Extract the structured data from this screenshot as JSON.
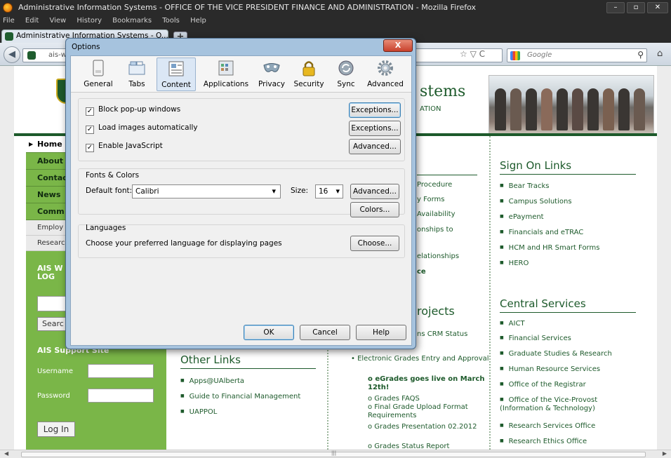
{
  "window": {
    "title": "Administrative Information Systems - OFFICE OF THE VICE PRESIDENT FINANCE AND ADMINISTRATION - Mozilla Firefox",
    "minimize": "–",
    "maximize": "▫",
    "close": "✕"
  },
  "menu": [
    "File",
    "Edit",
    "View",
    "History",
    "Bookmarks",
    "Tools",
    "Help"
  ],
  "tab": {
    "label": "Administrative Information Systems - O...",
    "new_tab": "+"
  },
  "nav": {
    "url": "ais-w",
    "search_placeholder": "Google",
    "back": "◀",
    "home": "⌂",
    "url_icons": "☆ ▽ C"
  },
  "site": {
    "name_partial": "stems",
    "unit_partial": "ATION",
    "left_nav": [
      "Home",
      "About",
      "Contac",
      "News",
      "Comm"
    ],
    "left_sub": [
      "Employ",
      "Researc"
    ],
    "ais_web": "AIS W LOG",
    "search_button": "Searc",
    "support_title": "AIS Support Site",
    "username_label": "Username",
    "password_label": "Password",
    "login_button": "Log In",
    "mid_links": [
      "Procedure",
      "y Forms",
      "Availability",
      "onships to",
      "elationships",
      "ce"
    ],
    "green_projects": "rojects",
    "crm_status": "ns CRM Status",
    "grades": {
      "head": "Electronic Grades Entry and Approval",
      "live": "eGrades goes live on March 12th!",
      "faqs": "Grades FAQS",
      "upload": "Final Grade Upload Format Requirements",
      "presentation": "Grades Presentation 02.2012",
      "status": "Grades Status Report"
    },
    "other_links_title": "Other Links",
    "other_links": [
      "Apps@UAlberta",
      "Guide to Financial Management",
      "UAPPOL"
    ],
    "signon_title": "Sign On Links",
    "signon_links": [
      "Bear Tracks",
      "Campus Solutions",
      "ePayment",
      "Financials and eTRAC",
      "HCM and HR Smart Forms",
      "HERO"
    ],
    "central_title": "Central Services",
    "central_links": [
      "AICT",
      "Financial Services",
      "Graduate Studies & Research",
      "Human Resource Services",
      "Office of the Registrar",
      "Office of the Vice-Provost (Information & Technology)",
      "Research Services Office",
      "Research Ethics Office"
    ]
  },
  "dialog": {
    "title": "Options",
    "close": "X",
    "tabs": [
      {
        "label": "General",
        "icon": "general-icon"
      },
      {
        "label": "Tabs",
        "icon": "tabs-icon"
      },
      {
        "label": "Content",
        "icon": "content-icon",
        "selected": true
      },
      {
        "label": "Applications",
        "icon": "applications-icon"
      },
      {
        "label": "Privacy",
        "icon": "privacy-mask-icon"
      },
      {
        "label": "Security",
        "icon": "padlock-icon"
      },
      {
        "label": "Sync",
        "icon": "sync-icon"
      },
      {
        "label": "Advanced",
        "icon": "gear-icon"
      }
    ],
    "block_popups": "Block pop-up windows",
    "load_images": "Load images automatically",
    "enable_js": "Enable JavaScript",
    "exceptions1": "Exceptions...",
    "exceptions2": "Exceptions...",
    "advanced_js": "Advanced...",
    "fonts_colors": "Fonts & Colors",
    "default_font_label": "Default font:",
    "default_font": "Calibri",
    "size_label": "Size:",
    "size": "16",
    "advanced_fonts": "Advanced...",
    "colors": "Colors...",
    "languages": "Languages",
    "languages_desc": "Choose your preferred language for displaying pages",
    "choose": "Choose...",
    "ok": "OK",
    "cancel": "Cancel",
    "help": "Help",
    "checked_mark": "✓"
  }
}
